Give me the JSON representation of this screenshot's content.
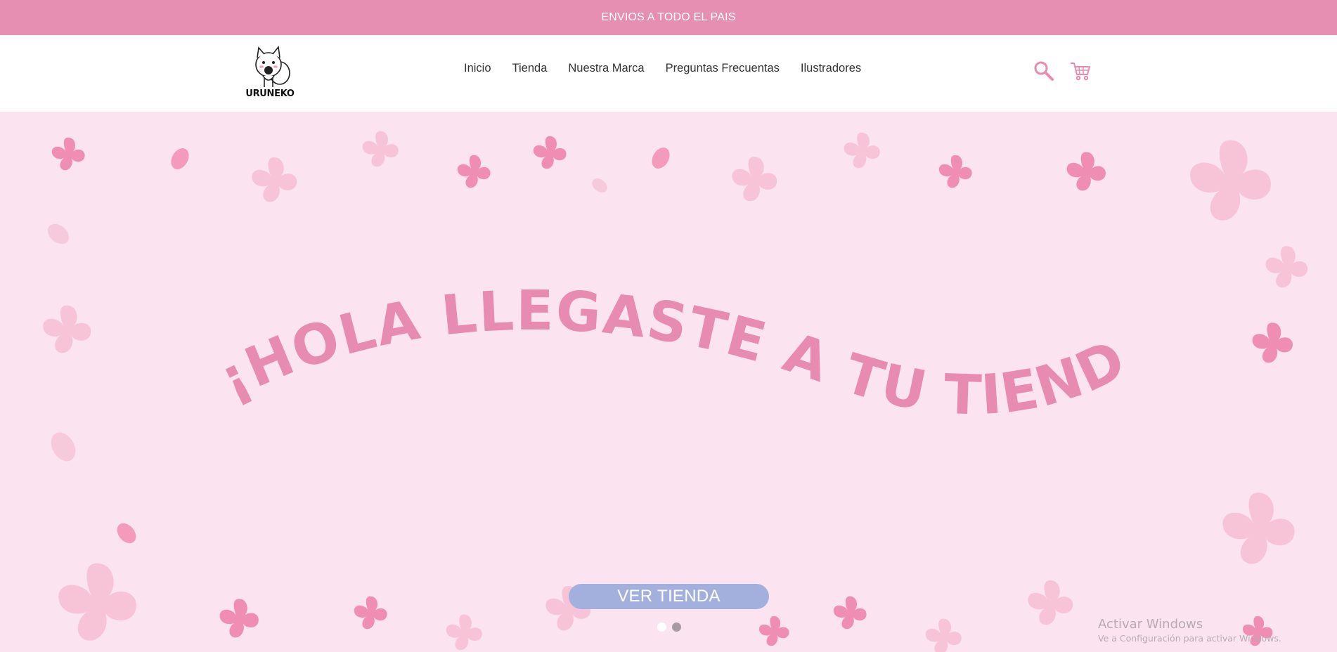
{
  "topbar": {
    "message": "ENVIOS A TODO EL PAIS"
  },
  "logo": {
    "text": "URUNEKO"
  },
  "nav": {
    "items": [
      {
        "label": "Inicio"
      },
      {
        "label": "Tienda"
      },
      {
        "label": "Nuestra Marca"
      },
      {
        "label": "Preguntas Frecuentas"
      },
      {
        "label": "Ilustradores"
      }
    ]
  },
  "icons": {
    "search": "search-icon",
    "cart": "cart-icon"
  },
  "hero": {
    "headline": "¡HOLA LLEGASTE A TU TIENDA KAWAII!",
    "cta_label": "VER TIENDA",
    "slides_total": 2,
    "active_slide": 1
  },
  "watermark": {
    "line1": "Activar Windows",
    "line2": "Ve a Configuración para activar Windows."
  },
  "colors": {
    "topbar": "#e78fb3",
    "hero_bg": "#fbe4ef",
    "accent_pink": "#e88bb0",
    "cta": "#a3b0dd"
  }
}
